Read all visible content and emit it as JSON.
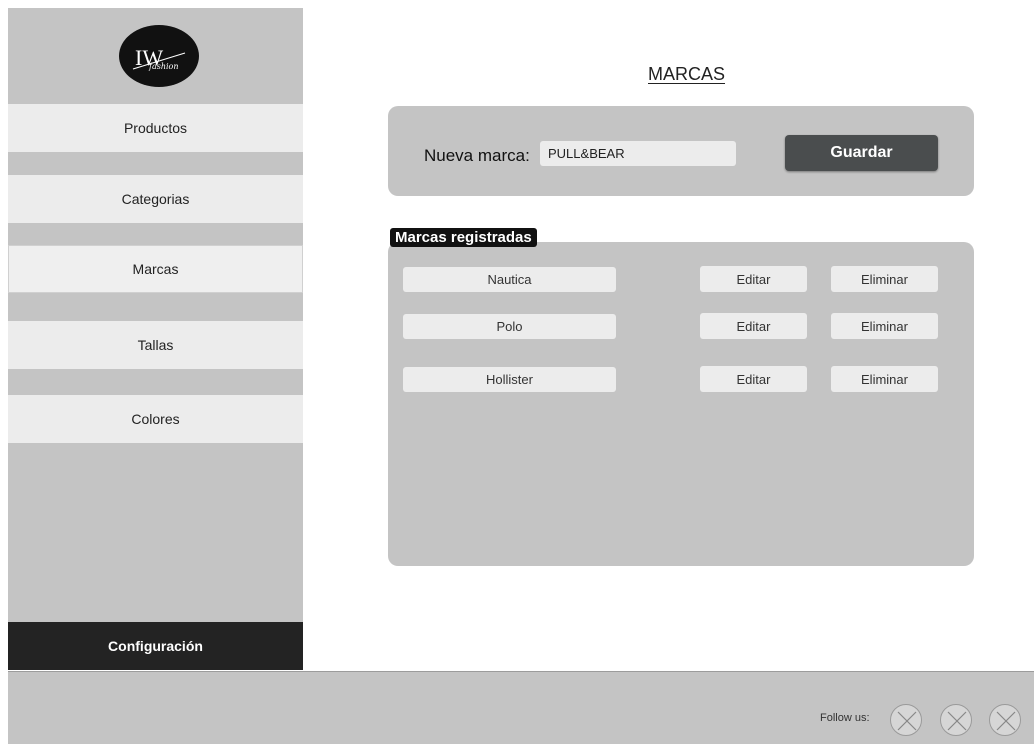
{
  "logo": {
    "text": "IW fashion"
  },
  "sidebar": {
    "items": [
      {
        "label": "Productos"
      },
      {
        "label": "Categorias"
      },
      {
        "label": "Marcas"
      },
      {
        "label": "Tallas"
      },
      {
        "label": "Colores"
      }
    ],
    "config_label": "Configuración"
  },
  "page": {
    "title": "MARCAS"
  },
  "new_brand": {
    "label": "Nueva marca:",
    "value": "PULL&BEAR",
    "save_label": "Guardar"
  },
  "registered": {
    "heading": "Marcas registradas",
    "edit_label": "Editar",
    "delete_label": "Eliminar",
    "brands": [
      {
        "name": "Nautica"
      },
      {
        "name": "Polo"
      },
      {
        "name": "Hollister"
      }
    ]
  },
  "footer": {
    "follow_label": "Follow us:",
    "social_icons": [
      "placeholder-icon",
      "placeholder-icon",
      "placeholder-icon"
    ]
  },
  "colors": {
    "panel": "#c4c4c4",
    "field": "#ececec",
    "primary_button": "#4a4d4e",
    "dark": "#232323"
  }
}
